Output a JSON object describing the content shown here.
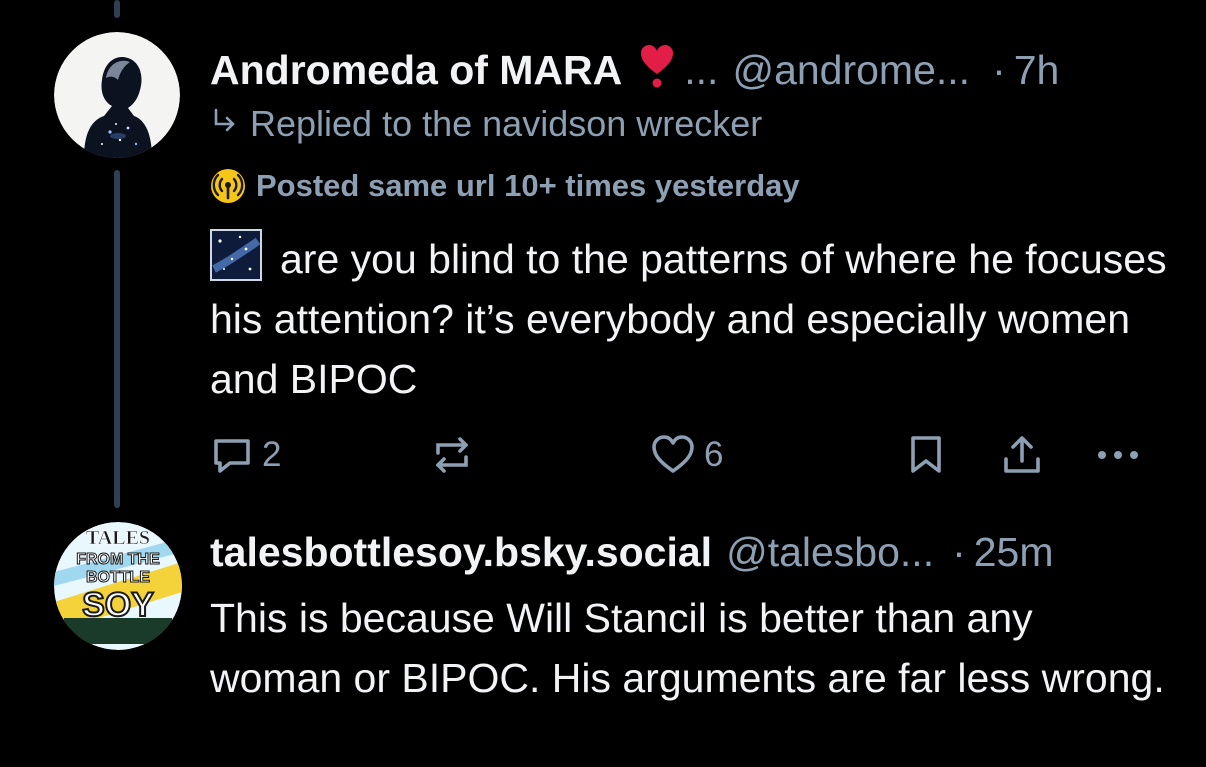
{
  "post1": {
    "author": "Andromeda of MARA",
    "heart_emoji": "❣",
    "ellipsis": "...",
    "handle": "@androme...",
    "separator": "·",
    "time": "7h",
    "reply_to": "Replied to the navidson wrecker",
    "label": "Posted same url 10+ times yesterday",
    "text": "are you blind to the patterns of where he focuses his attention? it’s everybody and especially women and BIPOC",
    "reply_count": "2",
    "like_count": "6"
  },
  "post2": {
    "author": "talesbottlesoy.bsky.social",
    "handle": "@talesbo...",
    "separator": "·",
    "time": "25m",
    "text": "This is because Will Stancil is better than any woman or BIPOC. His arguments are far less wrong.",
    "avatar_text": {
      "line1": "TALES",
      "line2": "FROM THE",
      "line3": "BOTTLE",
      "line4": "SOY"
    }
  },
  "colors": {
    "background": "#000000",
    "text": "#f1f3f5",
    "muted": "#8d9fb3",
    "thread_line": "#2e4052",
    "heart": "#e11d48"
  },
  "icons": {
    "reply": "reply-icon",
    "repost": "repost-icon",
    "like": "heart-icon",
    "bookmark": "bookmark-icon",
    "share": "share-icon",
    "more": "more-icon",
    "label": "broadcast-icon"
  }
}
